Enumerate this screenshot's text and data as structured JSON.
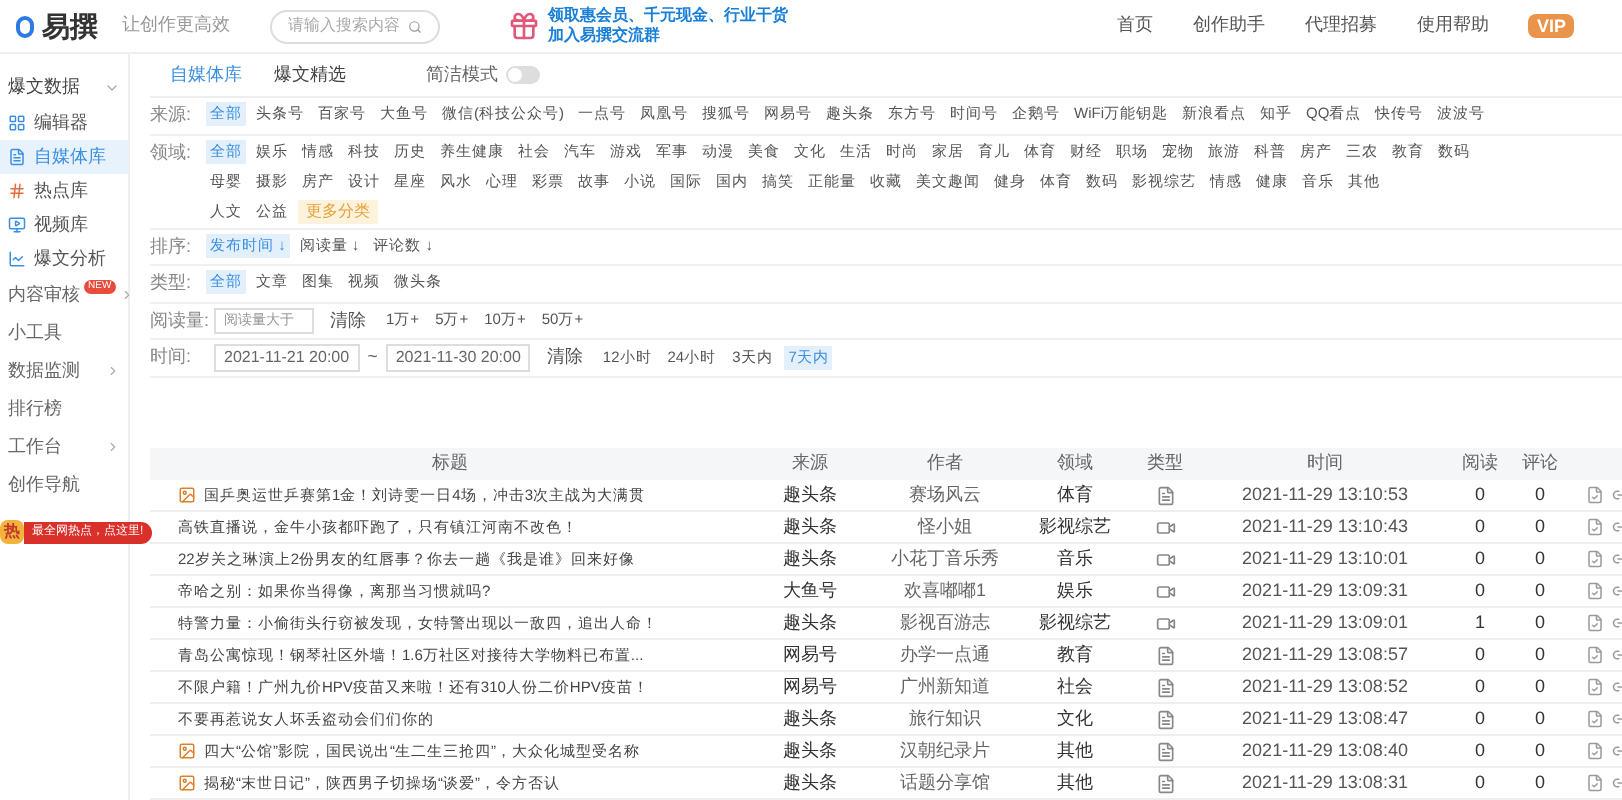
{
  "header": {
    "logo": "易撰",
    "slogan": "让创作更高效",
    "search_placeholder": "请输入搜索内容",
    "promo": [
      "领取惠会员、千元现金、行业干货",
      "加入易撰交流群"
    ],
    "nav": [
      "首页",
      "创作助手",
      "代理招募",
      "使用帮助"
    ],
    "vip": "VIP"
  },
  "sidebar": {
    "items": [
      {
        "kind": "header",
        "label": "爆文数据"
      },
      {
        "kind": "item",
        "label": "编辑器",
        "selected": false
      },
      {
        "kind": "item",
        "label": "自媒体库",
        "selected": true
      },
      {
        "kind": "item",
        "label": "热点库",
        "selected": false
      },
      {
        "kind": "item",
        "label": "视频库",
        "selected": false
      },
      {
        "kind": "item",
        "label": "爆文分析",
        "selected": false
      },
      {
        "kind": "group",
        "label": "内容审核",
        "badge": "NEW"
      },
      {
        "kind": "plain",
        "label": "小工具"
      },
      {
        "kind": "group",
        "label": "数据监测"
      },
      {
        "kind": "plain",
        "label": "排行榜"
      },
      {
        "kind": "group",
        "label": "工作台"
      },
      {
        "kind": "plain",
        "label": "创作导航"
      }
    ],
    "promo": {
      "icon_text": "热",
      "text": "最全网热点，点这里!"
    }
  },
  "tabs": [
    {
      "label": "自媒体库",
      "selected": true
    },
    {
      "label": "爆文精选",
      "selected": false
    }
  ],
  "simple_mode": {
    "label": "简洁模式",
    "on": false
  },
  "filters": [
    {
      "label": "来源:",
      "lines": [
        [
          {
            "label": "全部",
            "selected": true
          },
          {
            "label": "头条号",
            "selected": false
          },
          {
            "label": "百家号",
            "selected": false
          },
          {
            "label": "大鱼号",
            "selected": false
          },
          {
            "label": "微信(科技公众号)",
            "selected": false
          },
          {
            "label": "一点号",
            "selected": false
          },
          {
            "label": "凤凰号",
            "selected": false
          },
          {
            "label": "搜狐号",
            "selected": false
          },
          {
            "label": "网易号",
            "selected": false
          },
          {
            "label": "趣头条",
            "selected": false
          },
          {
            "label": "东方号",
            "selected": false
          },
          {
            "label": "时间号",
            "selected": false
          },
          {
            "label": "企鹅号",
            "selected": false
          },
          {
            "label": "WiFi万能钥匙",
            "selected": false
          },
          {
            "label": "新浪看点",
            "selected": false
          },
          {
            "label": "知乎",
            "selected": false
          },
          {
            "label": "QQ看点",
            "selected": false
          },
          {
            "label": "快传号",
            "selected": false
          },
          {
            "label": "波波号",
            "selected": false
          }
        ]
      ]
    },
    {
      "label": "领域:",
      "lines": [
        [
          {
            "label": "全部",
            "selected": true
          },
          {
            "label": "娱乐",
            "selected": false
          },
          {
            "label": "情感",
            "selected": false
          },
          {
            "label": "科技",
            "selected": false
          },
          {
            "label": "历史",
            "selected": false
          },
          {
            "label": "养生健康",
            "selected": false
          },
          {
            "label": "社会",
            "selected": false
          },
          {
            "label": "汽车",
            "selected": false
          },
          {
            "label": "游戏",
            "selected": false
          },
          {
            "label": "军事",
            "selected": false
          },
          {
            "label": "动漫",
            "selected": false
          },
          {
            "label": "美食",
            "selected": false
          },
          {
            "label": "文化",
            "selected": false
          },
          {
            "label": "生活",
            "selected": false
          },
          {
            "label": "时尚",
            "selected": false
          },
          {
            "label": "家居",
            "selected": false
          },
          {
            "label": "育儿",
            "selected": false
          },
          {
            "label": "体育",
            "selected": false
          },
          {
            "label": "财经",
            "selected": false
          },
          {
            "label": "职场",
            "selected": false
          },
          {
            "label": "宠物",
            "selected": false
          },
          {
            "label": "旅游",
            "selected": false
          },
          {
            "label": "科普",
            "selected": false
          },
          {
            "label": "房产",
            "selected": false
          },
          {
            "label": "三农",
            "selected": false
          },
          {
            "label": "教育",
            "selected": false
          },
          {
            "label": "数码",
            "selected": false
          }
        ],
        [
          {
            "label": "母婴",
            "selected": false
          },
          {
            "label": "摄影",
            "selected": false
          },
          {
            "label": "房产",
            "selected": false
          },
          {
            "label": "设计",
            "selected": false
          },
          {
            "label": "星座",
            "selected": false
          },
          {
            "label": "风水",
            "selected": false
          },
          {
            "label": "心理",
            "selected": false
          },
          {
            "label": "彩票",
            "selected": false
          },
          {
            "label": "故事",
            "selected": false
          },
          {
            "label": "小说",
            "selected": false
          },
          {
            "label": "国际",
            "selected": false
          },
          {
            "label": "国内",
            "selected": false
          },
          {
            "label": "搞笑",
            "selected": false
          },
          {
            "label": "正能量",
            "selected": false
          },
          {
            "label": "收藏",
            "selected": false
          },
          {
            "label": "美文趣闻",
            "selected": false
          },
          {
            "label": "健身",
            "selected": false
          },
          {
            "label": "体育",
            "selected": false
          },
          {
            "label": "数码",
            "selected": false
          },
          {
            "label": "影视综艺",
            "selected": false
          },
          {
            "label": "情感",
            "selected": false
          },
          {
            "label": "健康",
            "selected": false
          },
          {
            "label": "音乐",
            "selected": false
          },
          {
            "label": "其他",
            "selected": false
          }
        ],
        [
          {
            "label": "人文",
            "selected": false
          },
          {
            "label": "公益",
            "selected": false
          }
        ]
      ],
      "more": "更多分类"
    },
    {
      "label": "排序:",
      "lines": [
        [
          {
            "label": "发布时间 ↓",
            "selected": true
          },
          {
            "label": "阅读量 ↓",
            "selected": false
          },
          {
            "label": "评论数 ↓",
            "selected": false
          }
        ]
      ]
    },
    {
      "label": "类型:",
      "lines": [
        [
          {
            "label": "全部",
            "selected": true
          },
          {
            "label": "文章",
            "selected": false
          },
          {
            "label": "图集",
            "selected": false
          },
          {
            "label": "视频",
            "selected": false
          },
          {
            "label": "微头条",
            "selected": false
          }
        ]
      ]
    }
  ],
  "read_filter": {
    "label": "阅读量:",
    "placeholder": "阅读量大于",
    "clear": "清除",
    "options": [
      {
        "label": "1万+",
        "selected": false
      },
      {
        "label": "5万+",
        "selected": false
      },
      {
        "label": "10万+",
        "selected": false
      },
      {
        "label": "50万+",
        "selected": false
      }
    ]
  },
  "time_filter": {
    "label": "时间:",
    "start": "2021-11-21 20:00",
    "separator": "~",
    "end": "2021-11-30 20:00",
    "clear": "清除",
    "options": [
      {
        "label": "12小时",
        "selected": false
      },
      {
        "label": "24小时",
        "selected": false
      },
      {
        "label": "3天内",
        "selected": false
      },
      {
        "label": "7天内",
        "selected": true
      }
    ]
  },
  "table": {
    "columns": [
      "标题",
      "来源",
      "作者",
      "领域",
      "类型",
      "时间",
      "阅读",
      "评论"
    ],
    "rows": [
      {
        "title": "国乒奥运世乒赛第1金！刘诗雯一日4场，冲击3次主战为大满贯",
        "thumb": true,
        "source": "趣头条",
        "author": "赛场风云",
        "domain": "体育",
        "kind": "article",
        "time": "2021-11-29 13:10:53",
        "reads": "0",
        "comments": "0"
      },
      {
        "title": "高铁直播说，金牛小孩都吓跑了，只有镇江河南不改色！",
        "thumb": false,
        "source": "趣头条",
        "author": "怪小姐",
        "domain": "影视综艺",
        "kind": "video",
        "time": "2021-11-29 13:10:43",
        "reads": "0",
        "comments": "0"
      },
      {
        "title": "22岁关之琳演上2份男友的红唇事？你去一趟《我是谁》回来好像",
        "thumb": false,
        "source": "趣头条",
        "author": "小花丁音乐秀",
        "domain": "音乐",
        "kind": "video",
        "time": "2021-11-29 13:10:01",
        "reads": "0",
        "comments": "0"
      },
      {
        "title": "帝哈之别：如果你当得像，离那当习惯就吗?",
        "thumb": false,
        "source": "大鱼号",
        "author": "欢喜嘟嘟1",
        "domain": "娱乐",
        "kind": "video",
        "time": "2021-11-29 13:09:31",
        "reads": "0",
        "comments": "0"
      },
      {
        "title": "特警力量：小偷街头行窃被发现，女特警出现以一敌四，追出人命！",
        "thumb": false,
        "source": "趣头条",
        "author": "影视百游志",
        "domain": "影视综艺",
        "kind": "video",
        "time": "2021-11-29 13:09:01",
        "reads": "1",
        "comments": "0"
      },
      {
        "title": "青岛公寓惊现！钢琴社区外墙！1.6万社区对接待大学物料已布置...",
        "thumb": false,
        "source": "网易号",
        "author": "办学一点通",
        "domain": "教育",
        "kind": "article",
        "time": "2021-11-29 13:08:57",
        "reads": "0",
        "comments": "0"
      },
      {
        "title": "不限户籍！广州九价HPV疫苗又来啦！还有310人份二价HPV疫苗！",
        "thumb": false,
        "source": "网易号",
        "author": "广州新知道",
        "domain": "社会",
        "kind": "article",
        "time": "2021-11-29 13:08:52",
        "reads": "0",
        "comments": "0"
      },
      {
        "title": "不要再惹说女人坏丢盗动会们们你的",
        "thumb": false,
        "source": "趣头条",
        "author": "旅行知识",
        "domain": "文化",
        "kind": "article",
        "time": "2021-11-29 13:08:47",
        "reads": "0",
        "comments": "0"
      },
      {
        "title": "四大“公馆”影院，国民说出“生二生三抢四”，大众化城型受名称",
        "thumb": true,
        "source": "趣头条",
        "author": "汉朝纪录片",
        "domain": "其他",
        "kind": "article",
        "time": "2021-11-29 13:08:40",
        "reads": "0",
        "comments": "0"
      },
      {
        "title": "揭秘“末世日记”，陕西男子切操场“谈爱”，令方否认",
        "thumb": true,
        "source": "趣头条",
        "author": "话题分享馆",
        "domain": "其他",
        "kind": "article",
        "time": "2021-11-29 13:08:31",
        "reads": "0",
        "comments": "0"
      }
    ]
  }
}
